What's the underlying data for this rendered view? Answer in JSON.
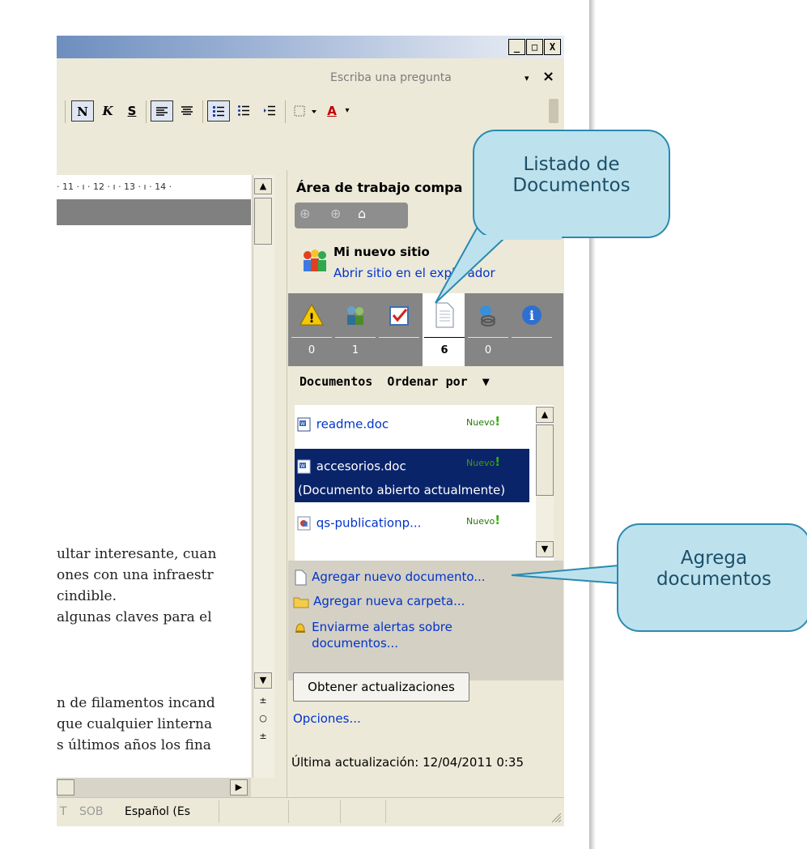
{
  "window": {
    "buttons": [
      "_",
      "□",
      "X"
    ],
    "ask_placeholder": "Escriba una pregunta",
    "ask_arrow": "▾",
    "ask_close": "×"
  },
  "toolbar": {
    "bold": "N",
    "italic": "K",
    "underline": "S",
    "font_color": "A"
  },
  "ruler": {
    "text": "· 11 · ı · 12 · ı · 13 · ı · 14 ·"
  },
  "document": {
    "lines_top": [
      "ultar interesante, cuan",
      "ones con una infraestr",
      "cindible.",
      "algunas claves para el"
    ],
    "lines_bottom": [
      "n de filamentos incand",
      "que cualquier linterna",
      "s últimos años los fina"
    ]
  },
  "statusbar": {
    "item1": "T",
    "item2": "SOB",
    "language": "Español (Es"
  },
  "pane": {
    "title": "Área de trabajo compa",
    "site_name": "Mi nuevo sitio",
    "site_link": "Abrir sitio en el explorador",
    "tabs": [
      {
        "icon": "warning-icon",
        "count": "0"
      },
      {
        "icon": "members-icon",
        "count": "1"
      },
      {
        "icon": "tasks-icon",
        "count": ""
      },
      {
        "icon": "document-icon",
        "count": "6"
      },
      {
        "icon": "links-icon",
        "count": "0"
      },
      {
        "icon": "info-icon",
        "count": ""
      }
    ],
    "documents_label": "Documentos",
    "sort_label": "Ordenar por",
    "documents": [
      {
        "name": "readme.doc",
        "badge": "Nuevo"
      },
      {
        "name": "accesorios.doc",
        "badge": "Nuevo",
        "note": "(Documento abierto actualmente)"
      },
      {
        "name": "qs-publicationp...",
        "badge": "Nuevo"
      }
    ],
    "actions": {
      "add_document": "Agregar nuevo documento...",
      "add_folder": "Agregar nueva carpeta...",
      "alerts_line1": "Enviarme alertas sobre",
      "alerts_line2": "documentos..."
    },
    "update_button": "Obtener actualizaciones",
    "options_link": "Opciones...",
    "last_update": "Última actualización: 12/04/2011 0:35"
  },
  "callouts": {
    "docs_list_line1": "Listado de",
    "docs_list_line2": "Documentos",
    "add_docs_line1": "Agrega",
    "add_docs_line2": "documentos"
  },
  "colors": {
    "accent": "#0a246a",
    "link": "#0033cc",
    "callout_fill": "#bde2ee",
    "callout_border": "#2a8ab0"
  }
}
